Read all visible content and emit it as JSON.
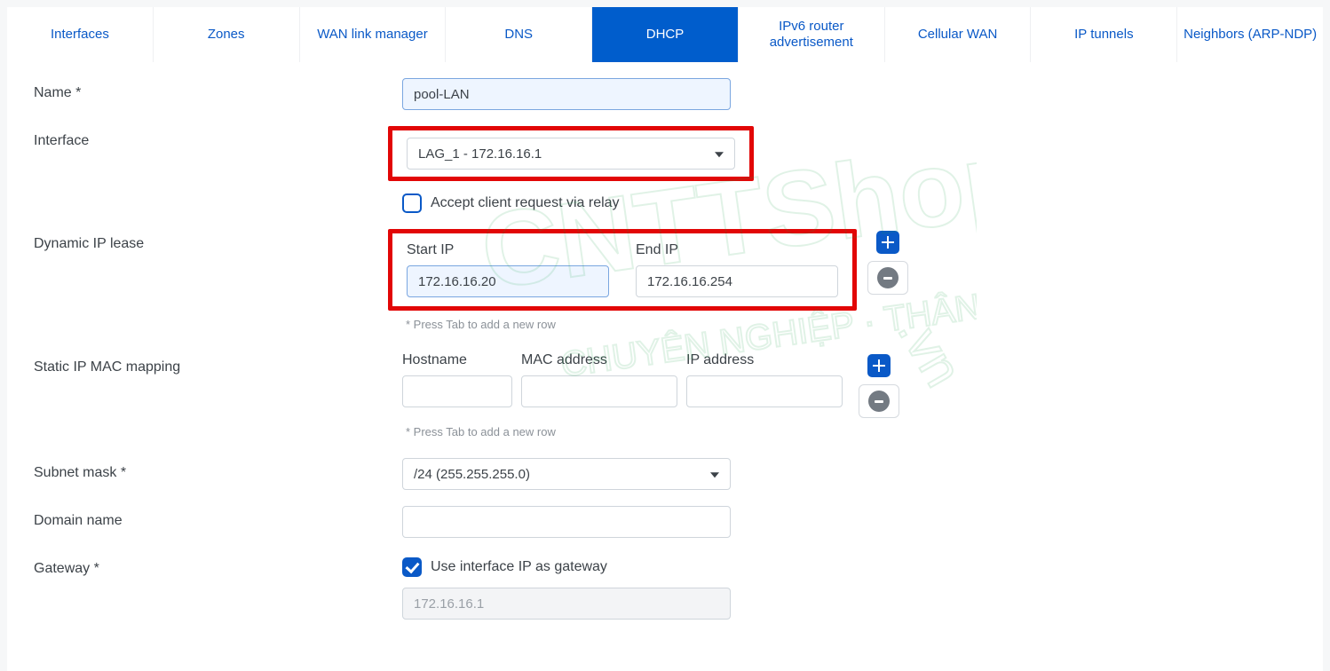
{
  "tabs": [
    {
      "label": "Interfaces",
      "active": false
    },
    {
      "label": "Zones",
      "active": false
    },
    {
      "label": "WAN link manager",
      "active": false
    },
    {
      "label": "DNS",
      "active": false
    },
    {
      "label": "DHCP",
      "active": true
    },
    {
      "label_line1": "IPv6 router",
      "label_line2": "advertisement",
      "active": false,
      "twoline": true
    },
    {
      "label": "Cellular WAN",
      "active": false
    },
    {
      "label": "IP tunnels",
      "active": false
    },
    {
      "label": "Neighbors (ARP-NDP)",
      "active": false
    }
  ],
  "form": {
    "name_label": "Name *",
    "name_value": "pool-LAN",
    "interface_label": "Interface",
    "interface_value": "LAG_1 - 172.16.16.1",
    "relay_checkbox_label": "Accept client request via relay",
    "relay_checked": false,
    "dyn_lease_label": "Dynamic IP lease",
    "lease_start_header": "Start IP",
    "lease_end_header": "End IP",
    "lease_start_value": "172.16.16.20",
    "lease_end_value": "172.16.16.254",
    "lease_hint": "* Press Tab to add a new row",
    "static_label": "Static IP MAC mapping",
    "static_hostname_header": "Hostname",
    "static_mac_header": "MAC address",
    "static_ip_header": "IP address",
    "static_hostname_value": "",
    "static_mac_value": "",
    "static_ip_value": "",
    "static_hint": "* Press Tab to add a new row",
    "subnet_label": "Subnet mask *",
    "subnet_value": "/24 (255.255.255.0)",
    "domain_label": "Domain name",
    "domain_value": "",
    "gateway_label": "Gateway *",
    "gateway_checkbox_label": "Use interface IP as gateway",
    "gateway_checked": true,
    "gateway_value": "172.16.16.1"
  }
}
